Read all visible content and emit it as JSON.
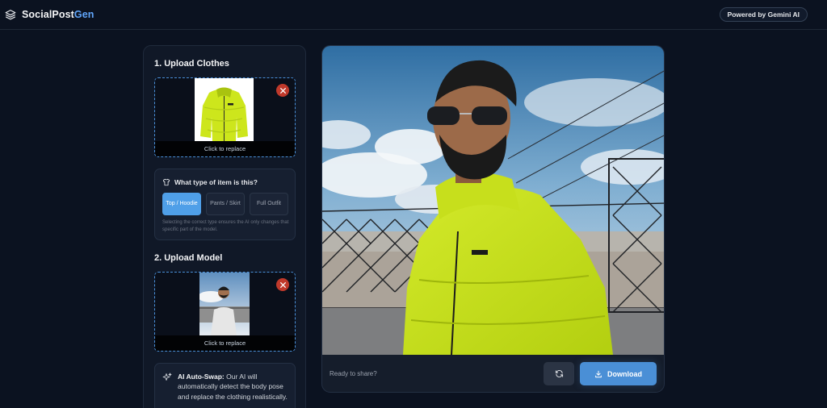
{
  "header": {
    "brand_prefix": "SocialPost",
    "brand_accent": "Gen",
    "badge": "Powered by Gemini AI"
  },
  "left": {
    "clothes_title": "1. Upload Clothes",
    "clothes_replace": "Click to replace",
    "type_question": "What type of item is this?",
    "type_options": [
      "Top / Hoodie",
      "Pants / Skirt",
      "Full Outfit"
    ],
    "type_selected": "Top / Hoodie",
    "type_note": "Selecting the correct type ensures the AI only changes that specific part of the model.",
    "model_title": "2. Upload Model",
    "model_replace": "Click to replace",
    "ai_label": "AI Auto-Swap:",
    "ai_text": " Our AI will automatically detect the body pose and replace the clothing realistically."
  },
  "right": {
    "status": "Ready to share?",
    "download_label": "Download"
  },
  "colors": {
    "background": "#0b1220",
    "panel": "#101827",
    "accent": "#4a8fd6",
    "jacket": "#cde61c",
    "remove": "#c0392b"
  },
  "icons": {
    "brand": "layers-icon",
    "shirt": "shirt-icon",
    "remove": "close-icon",
    "ai": "sparkles-icon",
    "refresh": "refresh-icon",
    "download": "download-icon"
  }
}
